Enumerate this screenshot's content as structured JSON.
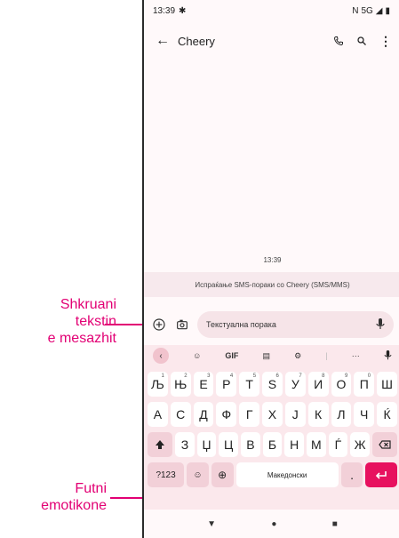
{
  "status": {
    "time": "13:39",
    "network": "5G"
  },
  "app_bar": {
    "contact": "Cheery"
  },
  "conversation": {
    "message_time": "13:39",
    "sms_banner": "Испраќање SMS-пораки со Cheery (SMS/MMS)"
  },
  "compose": {
    "placeholder": "Текстуална порака"
  },
  "keyboard": {
    "toolbar": {
      "gif": "GIF",
      "more": "···"
    },
    "row1": [
      {
        "label": "Љ",
        "hint": "1"
      },
      {
        "label": "Њ",
        "hint": "2"
      },
      {
        "label": "Е",
        "hint": "3"
      },
      {
        "label": "Р",
        "hint": "4"
      },
      {
        "label": "Т",
        "hint": "5"
      },
      {
        "label": "Ѕ",
        "hint": "6"
      },
      {
        "label": "У",
        "hint": "7"
      },
      {
        "label": "И",
        "hint": "8"
      },
      {
        "label": "О",
        "hint": "9"
      },
      {
        "label": "П",
        "hint": "0"
      },
      {
        "label": "Ш",
        "hint": ""
      }
    ],
    "row2": [
      "А",
      "С",
      "Д",
      "Ф",
      "Г",
      "Х",
      "Ј",
      "К",
      "Л",
      "Ч",
      "Ќ"
    ],
    "row3": [
      "З",
      "Џ",
      "Ц",
      "В",
      "Б",
      "Н",
      "М",
      "Ѓ",
      "Ж"
    ],
    "symbols_label": "?123",
    "space_label": "Македонски",
    "period_label": "."
  },
  "annotations": {
    "text_field": [
      "Shkruani",
      "tekstin",
      "e mesazhit"
    ],
    "emoji": [
      "Futni",
      "emotikone"
    ]
  },
  "colors": {
    "accent": "#e20074",
    "keyboard_bg": "#fbe8ec",
    "enter_key": "#e7115f"
  }
}
